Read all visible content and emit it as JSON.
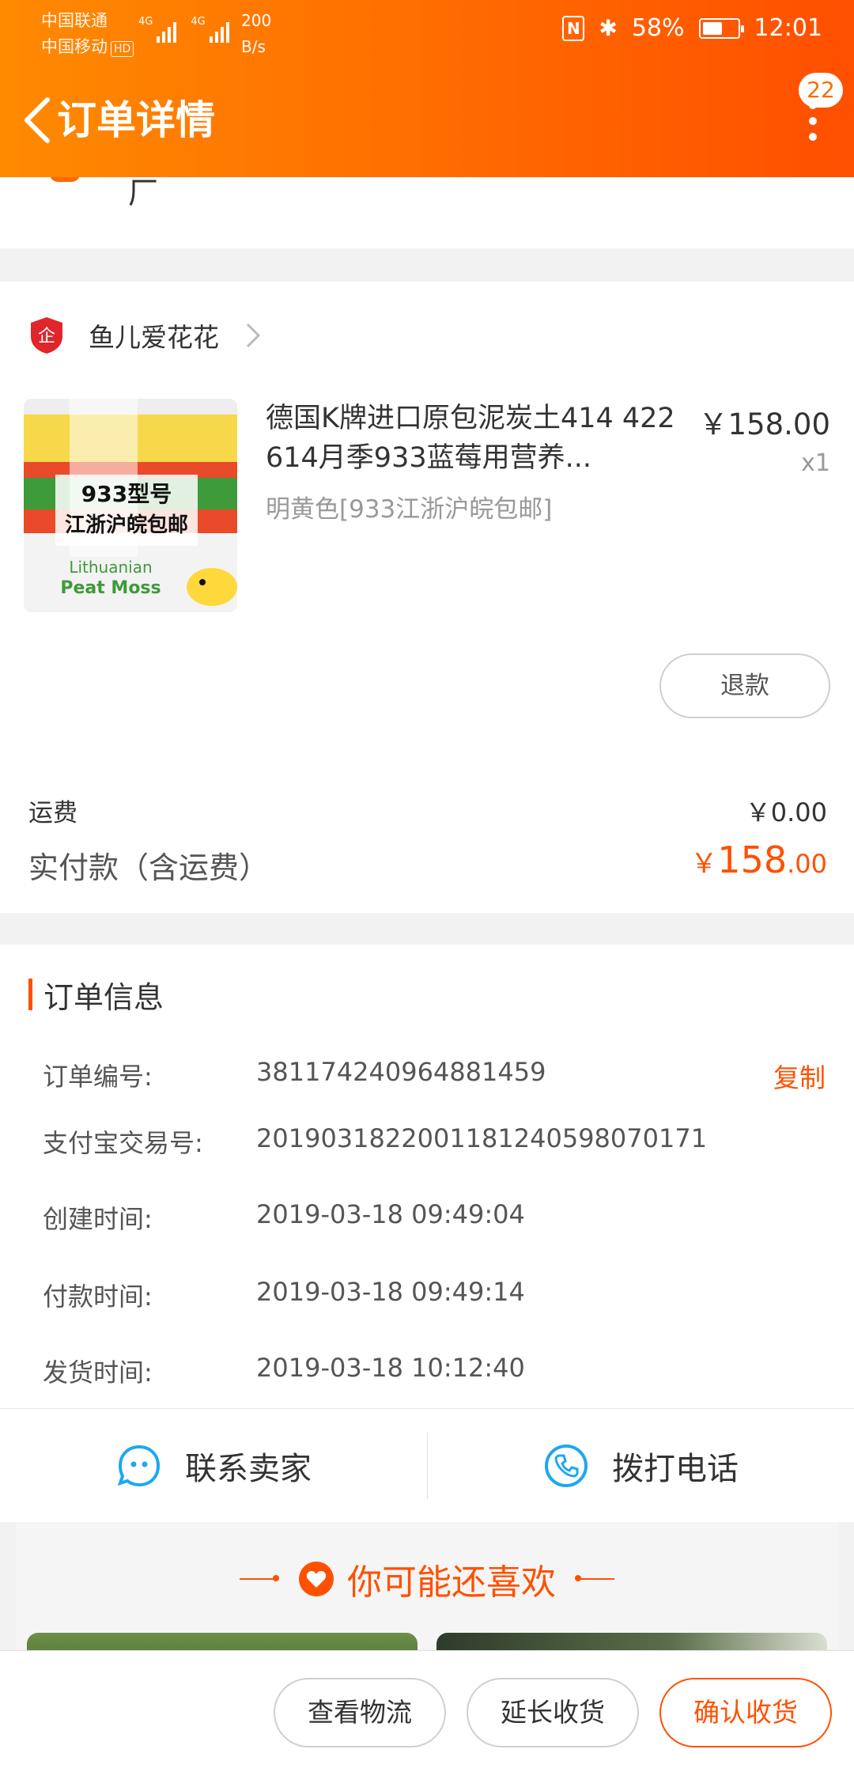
{
  "status_bar": {
    "carrier1": "中国联通",
    "carrier2": "中国移动",
    "hd": "HD",
    "net1": "4G",
    "net2": "4G",
    "speed_value": "200",
    "speed_unit": "B/s",
    "nfc": "N",
    "battery": "58%",
    "battery_level": 0.58,
    "time": "12:01"
  },
  "nav": {
    "title": "订单详情",
    "badge": "22"
  },
  "partial": {
    "text": "厂"
  },
  "shop": {
    "name": "鱼儿爱花花",
    "logo_glyph": "企"
  },
  "product": {
    "title": "德国K牌进口原包泥炭土414 422 614月季933蓝莓用营养...",
    "sku": "明黄色[933江浙沪皖包邮]",
    "price": "￥158.00",
    "qty": "x1",
    "image_text_1": "933型号",
    "image_text_2": "江浙沪皖包邮",
    "image_text_3": "Lithuanian",
    "image_text_4": "Peat Moss"
  },
  "refund_label": "退款",
  "freight": {
    "label": "运费",
    "value": "￥0.00"
  },
  "total": {
    "label": "实付款（含运费）",
    "yen": "￥",
    "int": "158",
    "dec": ".00"
  },
  "order_info": {
    "title": "订单信息",
    "copy_label": "复制",
    "rows": [
      {
        "k": "订单编号:",
        "v": "381174240964881459"
      },
      {
        "k": "支付宝交易号:",
        "v": "2019031822001181240598070171"
      },
      {
        "k": "创建时间:",
        "v": "2019-03-18 09:49:04"
      },
      {
        "k": "付款时间:",
        "v": "2019-03-18 09:49:14"
      },
      {
        "k": "发货时间:",
        "v": "2019-03-18 10:12:40"
      }
    ]
  },
  "contact": {
    "seller": "联系卖家",
    "phone": "拨打电话"
  },
  "recommend": {
    "title": "你可能还喜欢"
  },
  "bottom": {
    "logistics": "查看物流",
    "extend": "延长收货",
    "confirm": "确认收货"
  },
  "colors": {
    "accent": "#ff5000",
    "header_start": "#ff8a00",
    "header_end": "#ff4f00"
  }
}
